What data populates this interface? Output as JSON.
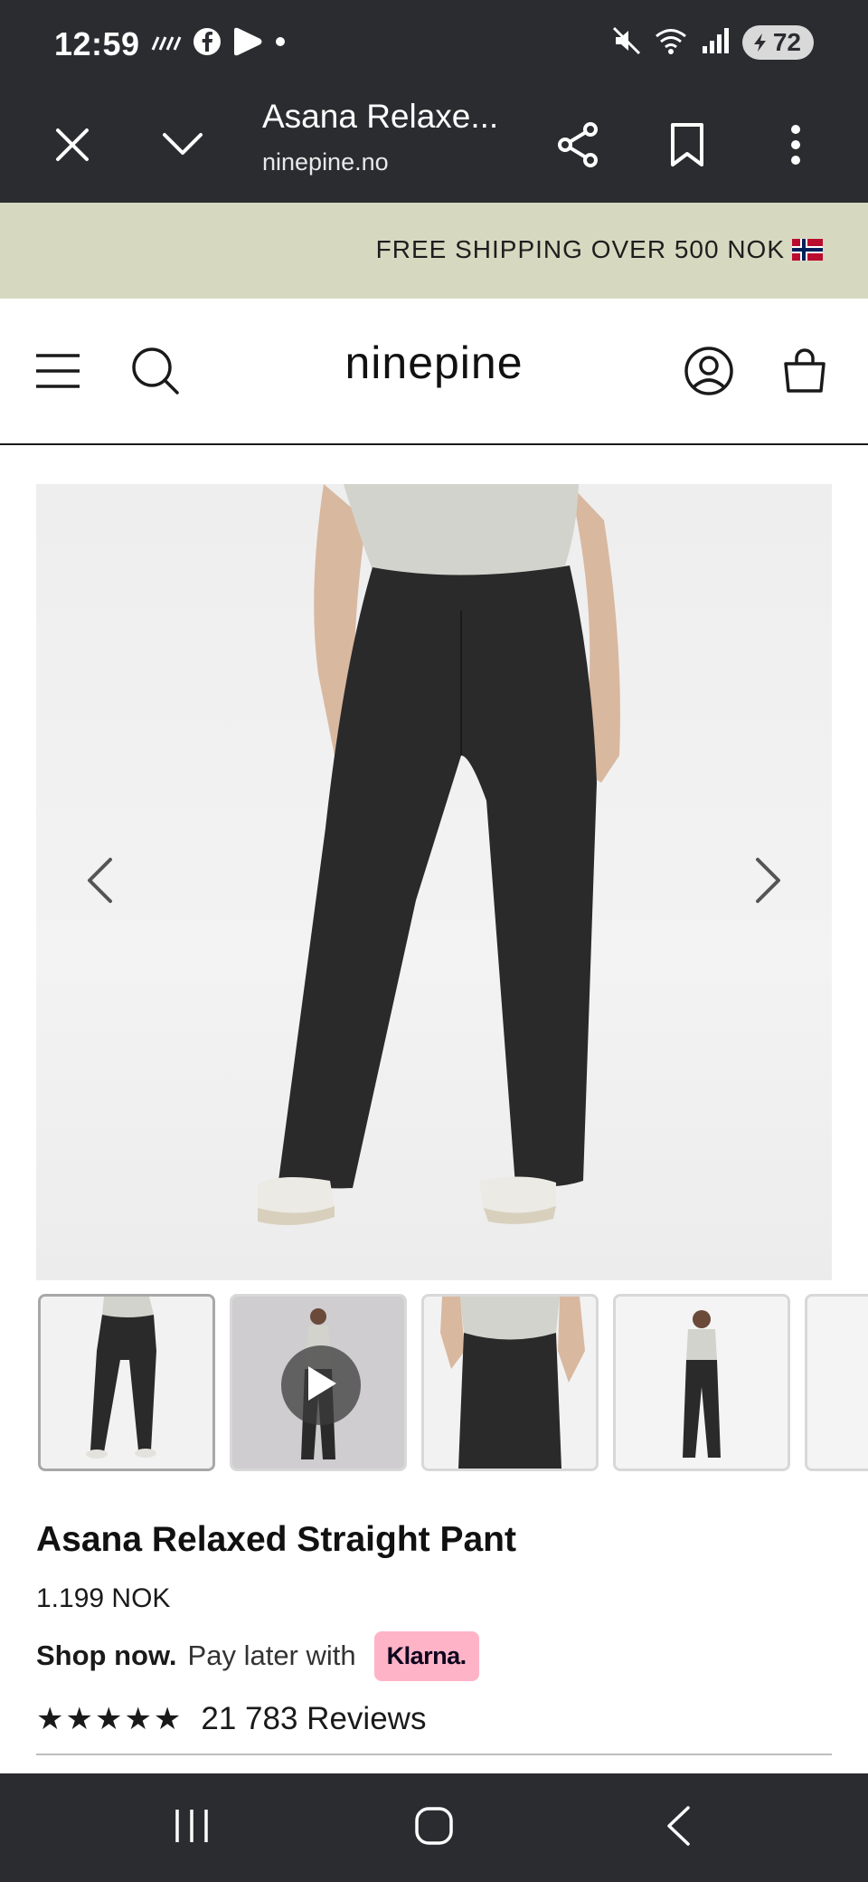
{
  "status_bar": {
    "time": "12:59",
    "battery": "72",
    "icons_left": [
      "wifi-calling-icon",
      "facebook-icon",
      "play-icon",
      "dot-icon"
    ],
    "icons_right": [
      "mute-icon",
      "wifi-icon",
      "signal-icon",
      "battery-icon"
    ]
  },
  "browser": {
    "title": "Asana Relaxe...",
    "url": "ninepine.no",
    "icons": [
      "close-icon",
      "chevron-down-icon",
      "share-icon",
      "bookmark-icon",
      "more-vert-icon"
    ]
  },
  "promo": {
    "text": "FREE SHIPPING OVER 500 NOK",
    "flag": "norway-flag-icon"
  },
  "header": {
    "logo": "ninepine",
    "icons": [
      "menu-icon",
      "search-icon",
      "account-icon",
      "cart-icon"
    ]
  },
  "gallery": {
    "thumbnails": [
      {
        "kind": "image",
        "active": true
      },
      {
        "kind": "video",
        "active": false
      },
      {
        "kind": "image",
        "active": false
      },
      {
        "kind": "image",
        "active": false
      },
      {
        "kind": "image",
        "active": false
      }
    ]
  },
  "product": {
    "title": "Asana Relaxed Straight Pant",
    "price": "1.199 NOK",
    "shop_now": "Shop now.",
    "pay_later": "Pay later with",
    "klarna": "Klarna.",
    "stars": "★★★★★",
    "rating": 5,
    "reviews": "21 783 Reviews"
  },
  "colors": {
    "chrome": "#2b2c30",
    "promo_bg": "#d6d9bf",
    "klarna_pink": "#ffb3c7",
    "pant": "#2a2a2a"
  }
}
